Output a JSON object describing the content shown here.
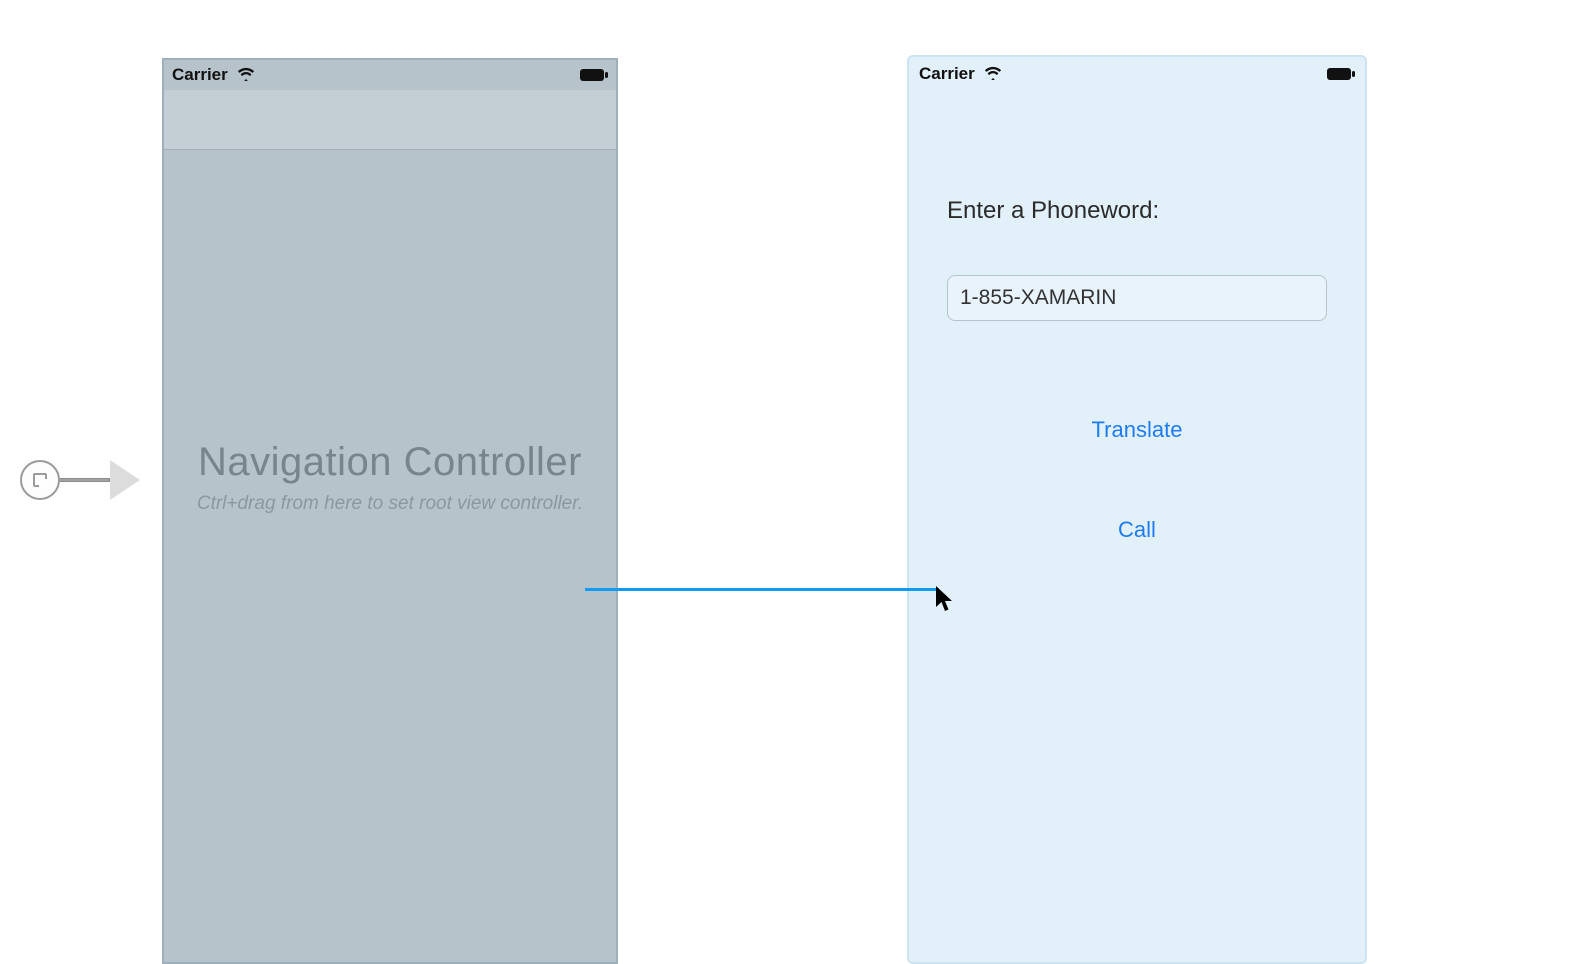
{
  "statusbar": {
    "carrier_label": "Carrier"
  },
  "nav_scene": {
    "title": "Navigation Controller",
    "subtitle": "Ctrl+drag from here to set root view controller."
  },
  "phoneword_scene": {
    "prompt_label": "Enter a Phoneword:",
    "input_value": "1-855-XAMARIN",
    "translate_label": "Translate",
    "call_label": "Call"
  },
  "colors": {
    "ios_tint": "#1e7cf2",
    "segue_line": "#0e9bf0",
    "nav_bg": "#b6c3cb",
    "view_bg": "#e2f0fa"
  }
}
